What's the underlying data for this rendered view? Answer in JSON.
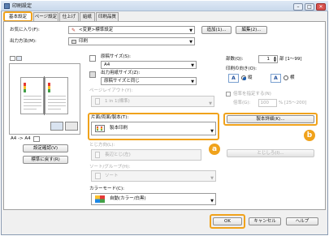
{
  "window": {
    "title": "印刷設定",
    "controls": [
      "–",
      "□",
      "✕"
    ]
  },
  "tabs": [
    {
      "label": "基本設定"
    },
    {
      "label": "ページ設定"
    },
    {
      "label": "仕上げ"
    },
    {
      "label": "給紙"
    },
    {
      "label": "印刷品質"
    }
  ],
  "favorites": {
    "label": "お気に入り(F):",
    "value": "<変更>標準設定",
    "add_button": "追加(1)...",
    "edit_button": "編集(2)..."
  },
  "output_method": {
    "label": "出力方法(M):",
    "value": "印刷"
  },
  "preview": {
    "caption": "A4 -> A4",
    "settings_button": "設定確認(V)",
    "restore_button": "標準に戻す(R)"
  },
  "paper": {
    "original_size_label": "原稿サイズ(S):",
    "original_size_value": "A4",
    "output_size_label": "出力用紙サイズ(Z):",
    "output_size_value": "原稿サイズと同じ",
    "page_layout_label": "ページレイアウト(Y):",
    "page_layout_value": "1 in 1(標準)"
  },
  "copies": {
    "label": "部数(Q):",
    "value": "1",
    "unit": "部 [1〜99]"
  },
  "orientation": {
    "label": "印刷の向き(O):",
    "portrait_glyph": "A",
    "portrait_label": "縦",
    "landscape_glyph": "A",
    "landscape_label": "横"
  },
  "scale": {
    "checkbox_label": "倍率を指定する(N)",
    "label": "倍率(G):",
    "value": "100",
    "unit": "% [25〜200]"
  },
  "duplex": {
    "label": "片面/両面/製本(T):",
    "value": "製本印刷",
    "detail_button": "製本詳細(K)..."
  },
  "binding": {
    "label": "とじ方向(L):",
    "value": "長辺とじ(左)",
    "margin_button": "とじしろ(I)..."
  },
  "collate": {
    "label": "ソート/グループ(H):",
    "value": "ソート"
  },
  "color_mode": {
    "label": "カラーモード(C):",
    "value": "自動(カラー/白黒)"
  },
  "badges": {
    "a": "a",
    "b": "b"
  },
  "footer": {
    "ok": "OK",
    "cancel": "キャンセル",
    "help": "ヘルプ"
  }
}
